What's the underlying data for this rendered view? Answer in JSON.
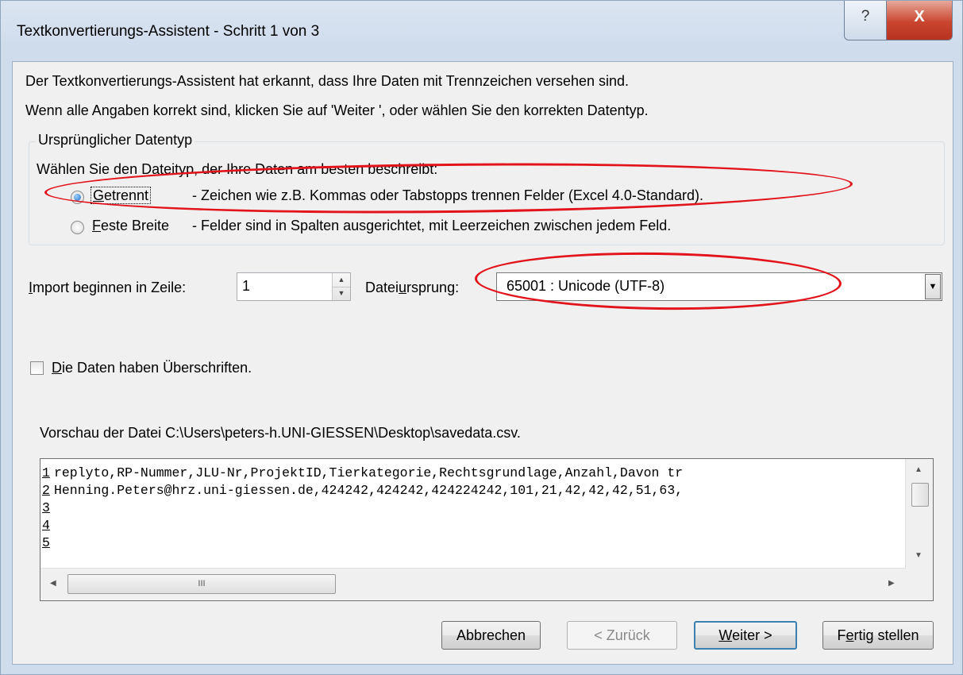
{
  "window": {
    "title": "Textkonvertierungs-Assistent - Schritt 1 von 3",
    "help_label": "?",
    "close_label": "X"
  },
  "intro": {
    "line1": "Der Textkonvertierungs-Assistent hat erkannt, dass Ihre Daten mit Trennzeichen versehen sind.",
    "line2": "Wenn alle Angaben korrekt sind, klicken Sie auf 'Weiter ', oder wählen Sie den korrekten Datentyp."
  },
  "datatype_group": {
    "legend": "Ursprünglicher Datentyp",
    "prompt": "Wählen Sie den Dateityp, der Ihre Daten am besten beschreibt:",
    "options": [
      {
        "label_accel": "G",
        "label_rest": "etrennt",
        "description": "- Zeichen wie z.B. Kommas oder Tabstopps trennen Felder (Excel 4.0-Standard).",
        "selected": true
      },
      {
        "label_accel": "F",
        "label_rest": "este Breite",
        "description": "- Felder sind in Spalten ausgerichtet, mit Leerzeichen zwischen jedem Feld.",
        "selected": false
      }
    ]
  },
  "import_start": {
    "label_accel": "I",
    "label_rest": "mport beginnen in Zeile:",
    "value": "1"
  },
  "file_origin": {
    "label_pre": "Datei",
    "label_accel": "u",
    "label_post": "rsprung:",
    "value": "65001 : Unicode (UTF-8)"
  },
  "headers_checkbox": {
    "label_accel": "D",
    "label_rest": "ie Daten haben Überschriften.",
    "checked": false
  },
  "preview": {
    "caption": "Vorschau der Datei C:\\Users\\peters-h.UNI-GIESSEN\\Desktop\\savedata.csv.",
    "rows": [
      {
        "num": "1",
        "text": "replyto,RP-Nummer,JLU-Nr,ProjektID,Tierkategorie,Rechtsgrundlage,Anzahl,Davon tr"
      },
      {
        "num": "2",
        "text": "Henning.Peters@hrz.uni-giessen.de,424242,424242,424224242,101,21,42,42,42,51,63,"
      },
      {
        "num": "3",
        "text": ""
      },
      {
        "num": "4",
        "text": ""
      },
      {
        "num": "5",
        "text": ""
      }
    ],
    "hthumb_grip": "III"
  },
  "buttons": {
    "cancel": "Abbrechen",
    "back": "< Zurück",
    "next_accel": "W",
    "next_rest": "eiter >",
    "finish_pre": "F",
    "finish_accel": "e",
    "finish_rest": "rtig stellen"
  },
  "annotation_color": "#e3131b"
}
